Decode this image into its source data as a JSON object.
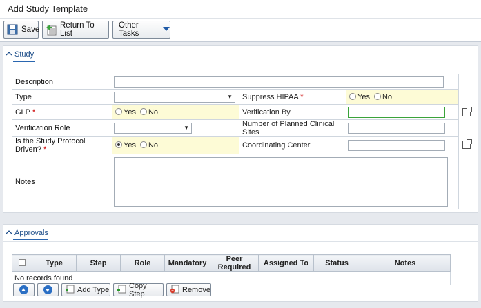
{
  "page": {
    "title": "Add Study Template"
  },
  "toolbar": {
    "save": "Save",
    "return_to_list": "Return To List",
    "other_tasks": "Other Tasks"
  },
  "study": {
    "header": "Study",
    "description_label": "Description",
    "type_label": "Type",
    "suppress_hipaa_label": "Suppress HIPAA",
    "glp_label": "GLP",
    "verification_by_label": "Verification By",
    "verification_role_label": "Verification Role",
    "planned_sites_label": "Number of Planned Clinical Sites",
    "protocol_driven_label": "Is the Study Protocol Driven?",
    "coordinating_center_label": "Coordinating Center",
    "notes_label": "Notes",
    "required_marker": "*",
    "yes": "Yes",
    "no": "No",
    "protocol_driven_value": "Yes"
  },
  "approvals": {
    "header": "Approvals",
    "columns": [
      "",
      "Type",
      "Step",
      "Role",
      "Mandatory",
      "Peer Required",
      "Assigned To",
      "Status",
      "Notes"
    ],
    "empty_text": "No records found",
    "add_type": "Add Type",
    "copy_step": "Copy Step",
    "remove": "Remove"
  },
  "colors": {
    "accent": "#2a66b0",
    "required_bg": "#fdfbd6",
    "focus_border": "#3aa33a"
  }
}
